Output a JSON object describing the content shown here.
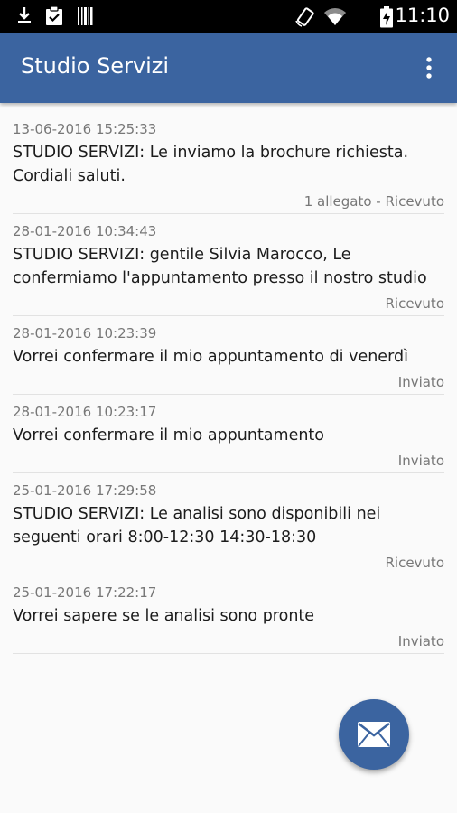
{
  "status_bar": {
    "time": "11:10",
    "icons": [
      "download-icon",
      "clipboard-check-icon",
      "barcode-icon",
      "rotate-icon",
      "wifi-icon",
      "battery-charging-icon"
    ]
  },
  "app_bar": {
    "title": "Studio Servizi",
    "menu_icon": "overflow-menu-icon"
  },
  "messages": [
    {
      "date": "13-06-2016 15:25:33",
      "text": "STUDIO SERVIZI: Le inviamo la brochure richiesta. Cordiali saluti.",
      "meta": "1 allegato - Ricevuto"
    },
    {
      "date": "28-01-2016 10:34:43",
      "text": "STUDIO SERVIZI: gentile Silvia Marocco, Le confermiamo l'appuntamento presso il nostro studio",
      "meta": "Ricevuto"
    },
    {
      "date": "28-01-2016 10:23:39",
      "text": "Vorrei confermare il mio appuntamento di venerdì",
      "meta": "Inviato"
    },
    {
      "date": "28-01-2016 10:23:17",
      "text": "Vorrei confermare il mio appuntamento",
      "meta": "Inviato"
    },
    {
      "date": "25-01-2016 17:29:58",
      "text": "STUDIO SERVIZI: Le analisi sono disponibili nei seguenti orari 8:00-12:30 14:30-18:30",
      "meta": "Ricevuto"
    },
    {
      "date": "25-01-2016 17:22:17",
      "text": "Vorrei sapere se le analisi sono pronte",
      "meta": "Inviato"
    }
  ],
  "fab": {
    "icon": "envelope-icon"
  },
  "colors": {
    "primary": "#3b64a0",
    "background": "#fafafa",
    "secondary_text": "#777777"
  }
}
